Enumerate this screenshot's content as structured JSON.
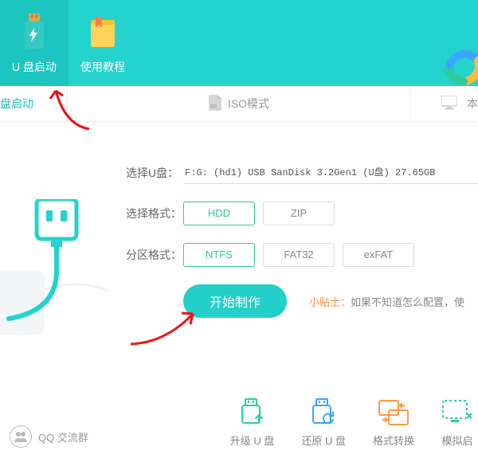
{
  "topbar": {
    "tabs": [
      {
        "label": "U 盘启动"
      },
      {
        "label": "使用教程"
      }
    ]
  },
  "modebar": {
    "left": "盘启动",
    "iso": "ISO模式",
    "right": "本"
  },
  "form": {
    "disk_label": "选择U盘：",
    "disk_value": "F:G: (hd1)  USB SanDisk 3.2Gen1 (U盘) 27.65GB",
    "mode_label": "选择格式：",
    "modes": [
      "HDD",
      "ZIP"
    ],
    "fs_label": "分区格式：",
    "fss": [
      "NTFS",
      "FAT32",
      "exFAT"
    ],
    "start": "开始制作",
    "tip_prefix": "小贴士：",
    "tip_rest": "如果不知道怎么配置，使"
  },
  "bottom": {
    "qq": "QQ 交流群",
    "actions": [
      {
        "label": "升级 U 盘",
        "color": "#2dcb9d"
      },
      {
        "label": "还原 U 盘",
        "color": "#3aa7ff"
      },
      {
        "label": "格式转换",
        "color": "#ff9a3c"
      },
      {
        "label": "模拟启",
        "color": "#2dcb9d"
      }
    ]
  }
}
